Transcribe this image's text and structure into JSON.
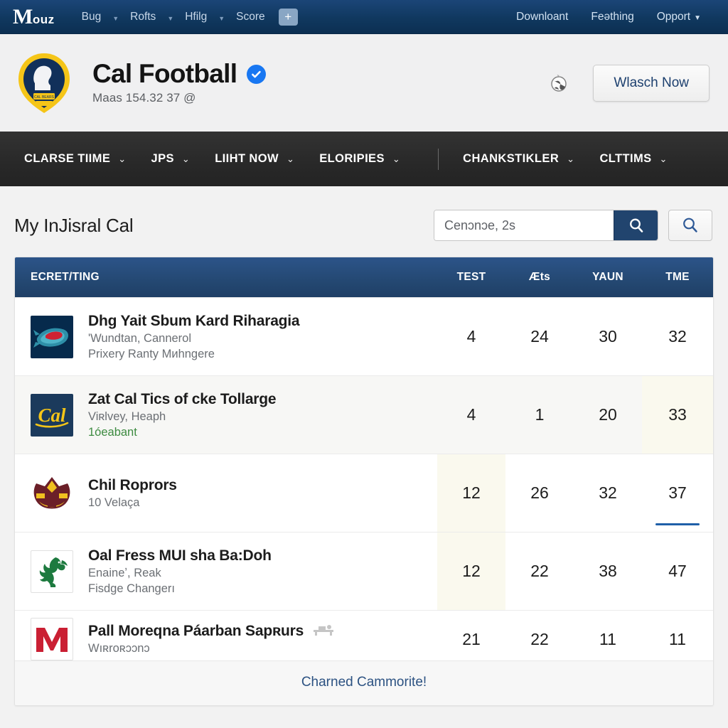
{
  "topnav": {
    "brand_m": "M",
    "brand_rest": "ouz",
    "left_items": [
      {
        "label": "Bug",
        "caret": "▼"
      },
      {
        "label": "Rofts",
        "caret": "▼"
      },
      {
        "label": "Hfilg",
        "caret": "▼"
      },
      {
        "label": "Score",
        "caret": ""
      }
    ],
    "plus_label": "+",
    "right_items": [
      {
        "label": "Downloant",
        "caret": ""
      },
      {
        "label": "Feəthing",
        "caret": ""
      },
      {
        "label": "Opport",
        "caret": "▼"
      }
    ],
    "bg_color": "#10385f"
  },
  "team_header": {
    "title": "Cal Football",
    "verified_icon": "check-badge-icon",
    "subtitle": "Maas 154.32 37 @",
    "globe_icon": "globe-icon",
    "watch_button": "Wlasch Now",
    "accent_color": "#1877f2"
  },
  "darknav": {
    "items": [
      {
        "label": "CLARSE TIIME",
        "caret": "⌄"
      },
      {
        "label": "JPS",
        "caret": "⌄"
      },
      {
        "label": "LIIHT NOW",
        "caret": "⌄"
      },
      {
        "label": "ELORIPIES",
        "caret": "⌄"
      },
      {
        "label": "CHANKSTIKLER",
        "caret": "⌄"
      },
      {
        "label": "CLTTIMS",
        "caret": "⌄"
      }
    ],
    "divider_after_index": 3,
    "bg_color": "#2a2a2a"
  },
  "section": {
    "title": "My InJisral Cal"
  },
  "search": {
    "placeholder": "Cenɔnɔe, 2s",
    "value": "",
    "submit_icon": "search-icon",
    "alt_icon": "search-icon",
    "button_color": "#21446e"
  },
  "table": {
    "header": {
      "main": "ECRET/TING",
      "cols": [
        "TEST",
        "Æts",
        "YAUN",
        "TME"
      ]
    },
    "rows": [
      {
        "logo": "fish-crest-icon",
        "logo_style": "navy",
        "title": "Dhg Yait Sbum Kard Riharagia",
        "sub1": "ʹWundtan, Cannerol",
        "sub2": "Prixery Ranty Mиhngere",
        "sub2_green": false,
        "trailing_icon": "",
        "values": [
          "4",
          "24",
          "30",
          "32"
        ],
        "shaded": false,
        "tinted_col": -1,
        "underlined_col": -1,
        "clipped": false
      },
      {
        "logo": "cal-script-icon",
        "logo_style": "cal",
        "title": "Zat Cal Tics of ckе Tollarge",
        "sub1": "Viʀlvey, Heaph",
        "sub2": "1óeabant",
        "sub2_green": true,
        "trailing_icon": "",
        "values": [
          "4",
          "1",
          "20",
          "33"
        ],
        "shaded": true,
        "tinted_col": 3,
        "underlined_col": -1,
        "clipped": false
      },
      {
        "logo": "crown-crest-icon",
        "logo_style": "bare",
        "title": "Chil Roprors",
        "sub1": "10 Velaça",
        "sub2": "",
        "sub2_green": false,
        "trailing_icon": "",
        "values": [
          "12",
          "26",
          "32",
          "37"
        ],
        "shaded": false,
        "tinted_col": 0,
        "underlined_col": 3,
        "clipped": false
      },
      {
        "logo": "lion-rampant-icon",
        "logo_style": "plain",
        "title": "Oal Fress MUI sha Ba:Doh",
        "sub1": "Enaineʼ, Reak",
        "sub2": "Fisdge Changerı",
        "sub2_green": false,
        "trailing_icon": "",
        "values": [
          "12",
          "22",
          "38",
          "47"
        ],
        "shaded": false,
        "tinted_col": 0,
        "underlined_col": -1,
        "clipped": false
      },
      {
        "logo": "block-m-icon",
        "logo_style": "plain",
        "title": "Pall Moreqna Páarban Sapʀurs",
        "sub1": "Wıʀroʀɔɔnɔ",
        "sub2": "",
        "sub2_green": false,
        "trailing_icon": "bench-icon",
        "values": [
          "21",
          "22",
          "11",
          "11"
        ],
        "shaded": false,
        "tinted_col": -1,
        "underlined_col": -1,
        "clipped": true
      }
    ],
    "footer_link": "Charned Cammorite!",
    "header_color": "#244872"
  }
}
